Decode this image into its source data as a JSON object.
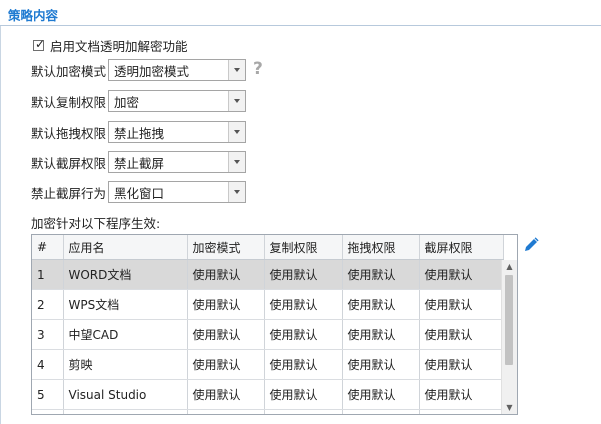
{
  "section": {
    "title": "策略内容"
  },
  "enable_checkbox": {
    "checked": true,
    "label": "启用文档透明加解密功能"
  },
  "form": [
    {
      "label": "默认加密模式",
      "value": "透明加密模式"
    },
    {
      "label": "默认复制权限",
      "value": "加密"
    },
    {
      "label": "默认拖拽权限",
      "value": "禁止拖拽"
    },
    {
      "label": "默认截屏权限",
      "value": "禁止截屏"
    },
    {
      "label": "禁止截屏行为",
      "value": "黑化窗口"
    }
  ],
  "help": {
    "icon": "question-icon",
    "glyph": "?"
  },
  "table": {
    "caption": "加密针对以下程序生效:",
    "columns": [
      "#",
      "应用名",
      "加密模式",
      "复制权限",
      "拖拽权限",
      "截屏权限"
    ],
    "rows": [
      [
        "1",
        "WORD文档",
        "使用默认",
        "使用默认",
        "使用默认",
        "使用默认"
      ],
      [
        "2",
        "WPS文档",
        "使用默认",
        "使用默认",
        "使用默认",
        "使用默认"
      ],
      [
        "3",
        "中望CAD",
        "使用默认",
        "使用默认",
        "使用默认",
        "使用默认"
      ],
      [
        "4",
        "剪映",
        "使用默认",
        "使用默认",
        "使用默认",
        "使用默认"
      ],
      [
        "5",
        "Visual Studio",
        "使用默认",
        "使用默认",
        "使用默认",
        "使用默认"
      ]
    ],
    "selected_row": 0
  },
  "icons": {
    "edit": "pencil-edit-icon",
    "dropdown": "chevron-down-icon"
  },
  "colors": {
    "accent": "#1f7ad1",
    "selected_row": "#d9d9d9"
  }
}
